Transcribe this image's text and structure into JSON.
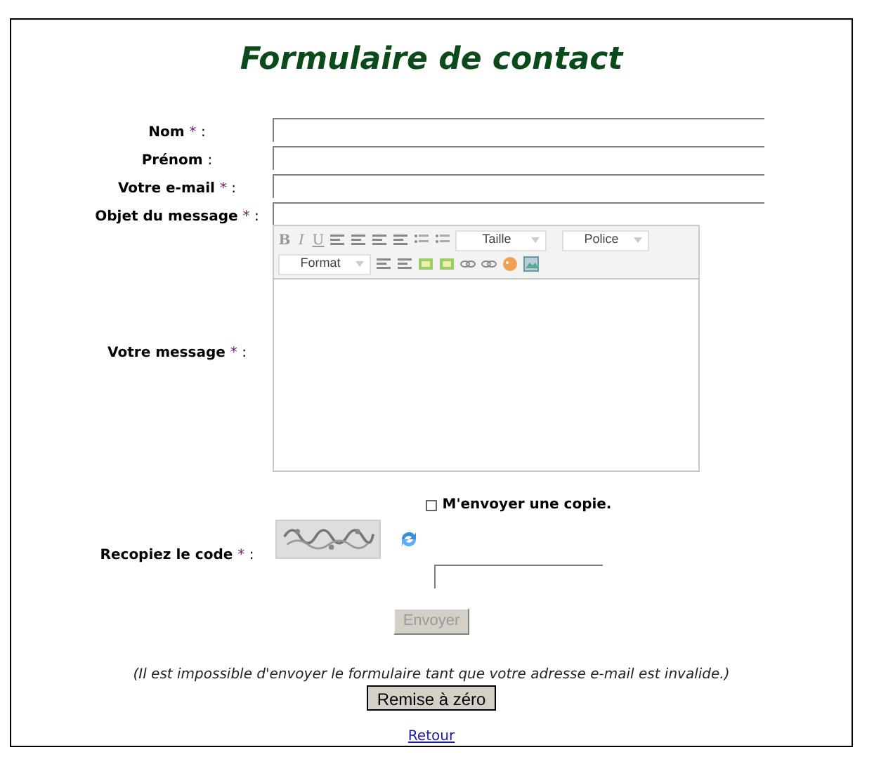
{
  "title": "Formulaire de contact",
  "fields": [
    {
      "label": "Nom",
      "mark": "*",
      "suffix": ":"
    },
    {
      "label": "Prénom",
      "suffix": ":"
    },
    {
      "label": "Votre e-mail",
      "mark": "*",
      "suffix": ":"
    },
    {
      "label": "Objet du message",
      "mark": "*",
      "suffix": ":"
    }
  ],
  "message": {
    "label": "Votre message",
    "mark": "*",
    "suffix": ":",
    "toolbar": {
      "format_buttons": [
        "B",
        "I",
        "U"
      ],
      "size_select": "Taille",
      "font_select": "Police",
      "format_select": "Format"
    }
  },
  "copy_checkbox": {
    "label": "M'envoyer une copie.",
    "checked": false
  },
  "captcha": {
    "label": "Recopiez le code",
    "mark": "*",
    "suffix": ":"
  },
  "submit": {
    "label": "Envoyer",
    "disabled": true
  },
  "note": "(Il est impossible d'envoyer le formulaire tant que votre adresse e-mail est invalide.)",
  "reset": {
    "label": "Remise à zéro"
  },
  "back_link": "Retour"
}
